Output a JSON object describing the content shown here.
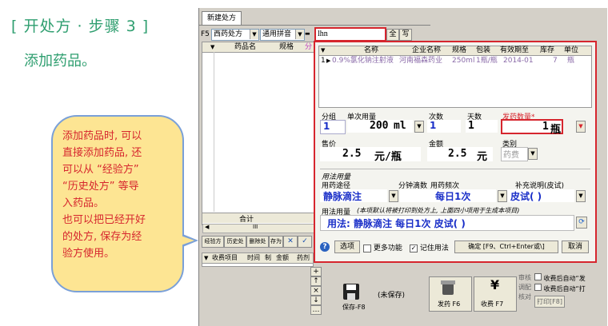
{
  "slide": {
    "title": "[ 开处方 · 步骤 3 ]",
    "subtitle": "添加药品。",
    "bubble_lines": [
      "添加药品时, 可以",
      "直接添加药品, 还",
      "可以从 “经验方”",
      "“历史处方” 等导",
      "入药品。",
      "也可以把已经开好",
      "的处方, 保存为经",
      "验方使用。"
    ]
  },
  "app": {
    "tab": "新建处方",
    "f5_label": "F5",
    "west_med_select": "西药处方",
    "pinyin_select": "通用拼音",
    "search_value": "lhn",
    "all_btn": "全",
    "write_btn": "写",
    "left_grid": {
      "headers": [
        "",
        "药品名",
        "规格",
        "分"
      ]
    },
    "subtotal_label": "合计",
    "scroll_label": "III",
    "import_btns": [
      "经验方",
      "历史处方",
      "删除处方",
      "存为经验方"
    ],
    "close_x": "✕",
    "check": "✓",
    "fee_headers": [
      "收费项目",
      "时间",
      "制",
      "金额",
      "药剂"
    ],
    "side_btns": [
      "+",
      "↑",
      "×",
      "↓",
      "…"
    ],
    "save_btn": "保存-F8",
    "save_status": "(未保存)"
  },
  "popup": {
    "grid_headers": [
      "名称",
      "企业名称",
      "规格",
      "包装",
      "有效期至",
      "库存",
      "单位"
    ],
    "row": {
      "idx": "1",
      "name": "0.9%氯化钠注射液",
      "maker": "河南福森药业",
      "spec": "250ml",
      "pack": "1瓶/瓶",
      "expiry": "2014-01",
      "stock": "7",
      "unit": "瓶"
    },
    "group_label": "分组",
    "group_value": "1",
    "dose_label": "单次用量",
    "dose_value": "200",
    "dose_unit": "ml",
    "times_label": "次数",
    "times_value": "1",
    "days_label": "天数",
    "days_value": "1",
    "qty_label": "发药数量*",
    "qty_value": "1",
    "qty_unit": "瓶",
    "price_label": "售价",
    "price_value": "2.5",
    "price_unit": "元/瓶",
    "amount_label": "金额",
    "amount_value": "2.5",
    "amount_unit": "元",
    "category_label": "类别",
    "category_value": "药费",
    "usage_section": "用法用量",
    "route_label": "用药途径",
    "route_value": "静脉滴注",
    "drip_label": "分钟滴数",
    "freq_label": "用药频次",
    "freq_value": "每日1次",
    "note_label": "补充说明(皮试)",
    "note_value": "皮试( )",
    "usage_text_label": "用法用量",
    "usage_text_hint": "(本项默认将被打印到处方上, 上面四小项用于生成本项目)",
    "usage_text_value": "用法: 静脉滴注 每日1次 皮试( )",
    "options_btn": "选项",
    "more_func": "更多功能",
    "remember_usage": "记住用法",
    "confirm_btn": "确定 [F9、Ctrl+Enter或\\]",
    "cancel_btn": "取消"
  },
  "bottom_right": {
    "check_labels": [
      "审核",
      "调配",
      "核对"
    ],
    "print_label": "打印[F8]",
    "auto1": "收费后自动“发",
    "auto2": "收费后自动“打",
    "dispense_btn": "发药 F6",
    "charge_btn": "收费 F7",
    "yen": "¥"
  }
}
